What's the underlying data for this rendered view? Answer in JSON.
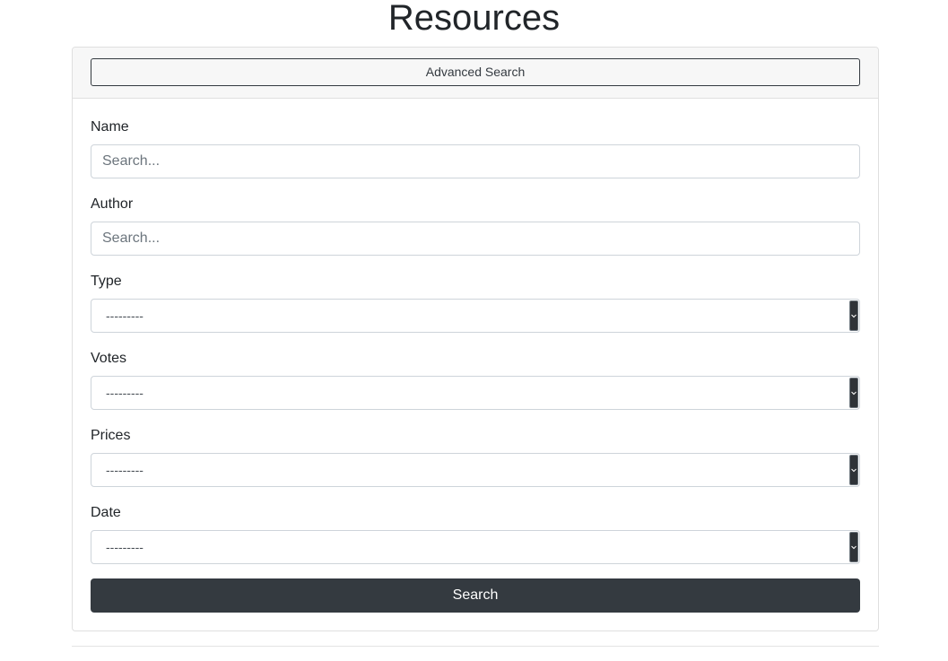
{
  "page": {
    "title": "Resources"
  },
  "card": {
    "advanced_search_label": "Advanced Search"
  },
  "form": {
    "name": {
      "label": "Name",
      "placeholder": "Search..."
    },
    "author": {
      "label": "Author",
      "placeholder": "Search..."
    },
    "type": {
      "label": "Type",
      "selected": "---------"
    },
    "votes": {
      "label": "Votes",
      "selected": "---------"
    },
    "prices": {
      "label": "Prices",
      "selected": "---------"
    },
    "date": {
      "label": "Date",
      "selected": "---------"
    },
    "submit_label": "Search"
  },
  "icons": {
    "select_arrow": "chevron-down-icon"
  },
  "colors": {
    "primary_dark": "#343a40",
    "header_bg": "#f7f7f7",
    "border": "#ced4da"
  }
}
